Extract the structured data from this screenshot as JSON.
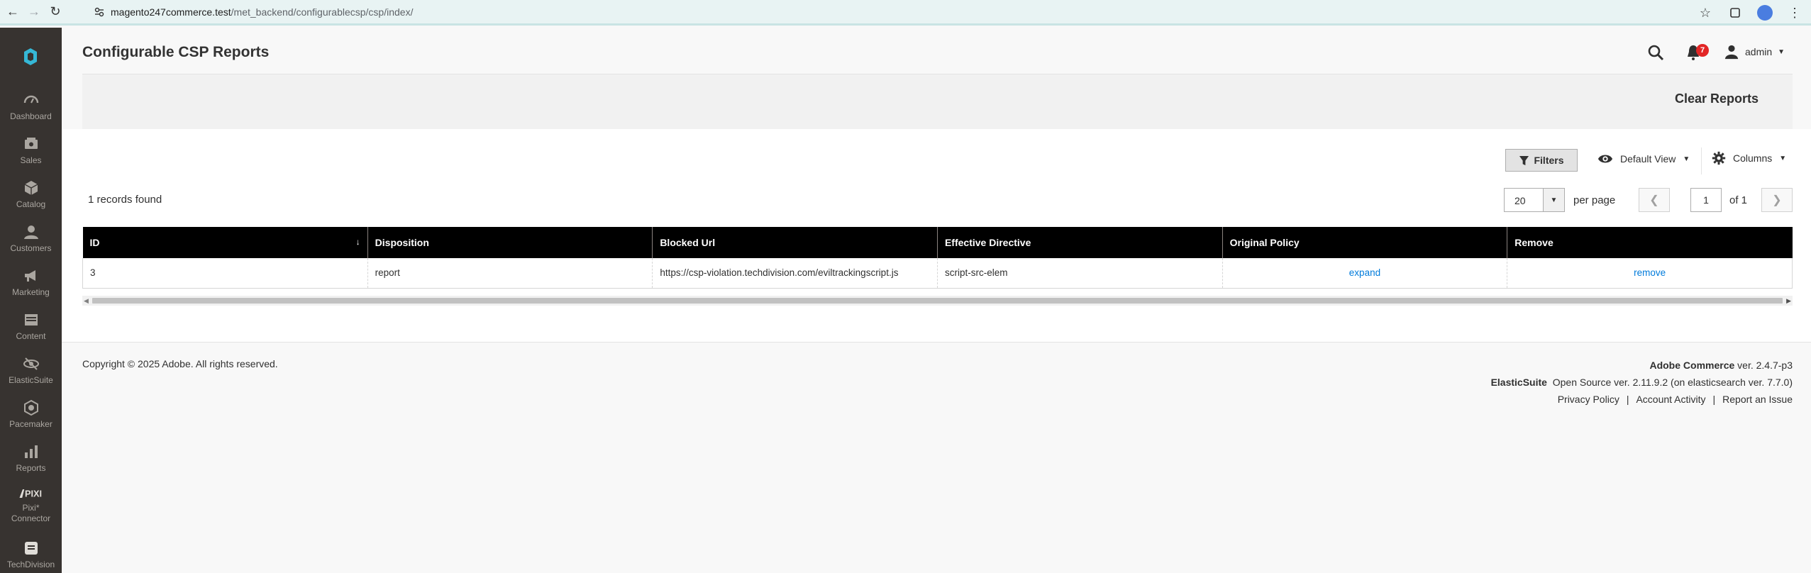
{
  "browser": {
    "url_host": "magento247commerce.test",
    "url_path": "/met_backend/configurablecsp/csp/index/"
  },
  "sidebar": {
    "items": [
      {
        "label": "Dashboard",
        "icon": "dashboard-icon"
      },
      {
        "label": "Sales",
        "icon": "sales-icon"
      },
      {
        "label": "Catalog",
        "icon": "catalog-icon"
      },
      {
        "label": "Customers",
        "icon": "customers-icon"
      },
      {
        "label": "Marketing",
        "icon": "marketing-icon"
      },
      {
        "label": "Content",
        "icon": "content-icon"
      },
      {
        "label": "ElasticSuite",
        "icon": "elasticsuite-icon"
      },
      {
        "label": "Pacemaker",
        "icon": "pacemaker-icon"
      },
      {
        "label": "Reports",
        "icon": "reports-icon"
      },
      {
        "label": "Pixi* Connector",
        "icon": "pixi-icon"
      },
      {
        "label": "TechDivision",
        "icon": "techdivision-icon"
      }
    ]
  },
  "header": {
    "title": "Configurable CSP Reports",
    "notifications": "7",
    "user": "admin"
  },
  "actions": {
    "clear_reports": "Clear Reports"
  },
  "toolbar": {
    "filters": "Filters",
    "view": "Default View",
    "columns": "Columns",
    "records_found": "1 records found",
    "per_page_value": "20",
    "per_page_label": "per page",
    "current_page": "1",
    "of_pages": "of 1"
  },
  "table": {
    "columns": [
      "ID",
      "Disposition",
      "Blocked Url",
      "Effective Directive",
      "Original Policy",
      "Remove"
    ],
    "rows": [
      {
        "id": "3",
        "disposition": "report",
        "blocked_url": "https://csp-violation.techdivision.com/eviltrackingscript.js",
        "effective_directive": "script-src-elem",
        "original_policy": "expand",
        "remove": "remove"
      }
    ]
  },
  "footer": {
    "copyright": "Copyright © 2025 Adobe. All rights reserved.",
    "product_name": "Adobe Commerce",
    "product_version": "ver. 2.4.7-p3",
    "elasticsuite_name": "ElasticSuite",
    "elasticsuite_version": "Open Source ver. 2.11.9.2 (on elasticsearch ver. 7.7.0)",
    "links": [
      "Privacy Policy",
      "Account Activity",
      "Report an Issue"
    ]
  },
  "colors": {
    "sidebar_bg": "#373330",
    "table_header_bg": "#000000",
    "link": "#007bdb",
    "badge": "#e22626"
  }
}
